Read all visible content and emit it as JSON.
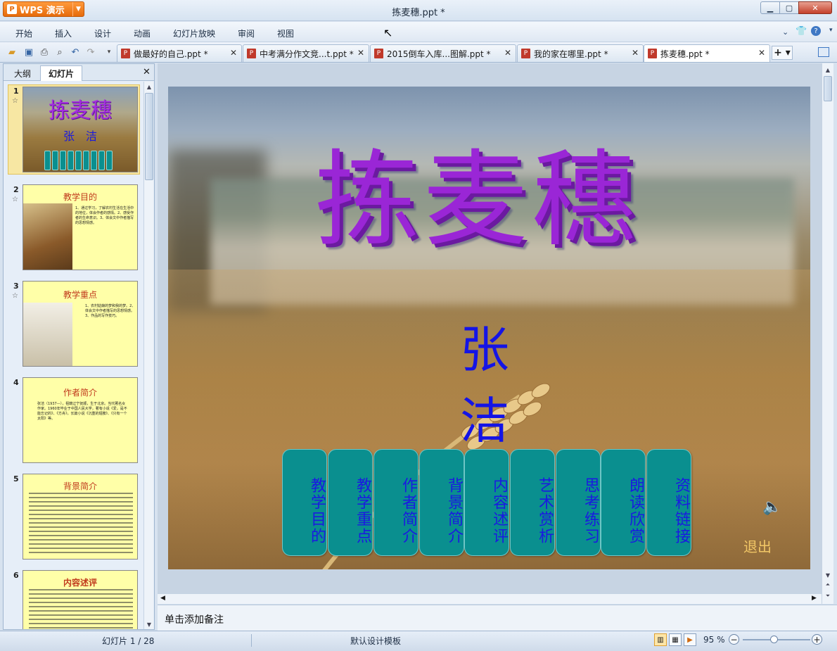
{
  "app": {
    "name": "WPS 演示",
    "window_title": "拣麦穗.ppt *"
  },
  "menu": [
    "开始",
    "插入",
    "设计",
    "动画",
    "幻灯片放映",
    "审阅",
    "视图"
  ],
  "doc_tabs": [
    {
      "label": "做最好的自己.ppt *"
    },
    {
      "label": "中考满分作文竞...t.ppt *"
    },
    {
      "label": "2015倒车入库...图解.ppt *"
    },
    {
      "label": "我的家在哪里.ppt *"
    },
    {
      "label": "拣麦穗.ppt *",
      "active": true
    }
  ],
  "left_panel": {
    "tab_outline": "大纲",
    "tab_slides": "幻灯片",
    "thumbs": [
      {
        "num": "1",
        "title": "拣麦穗",
        "subtitle": "张　洁",
        "selected": true
      },
      {
        "num": "2",
        "title": "教学目的",
        "text": "1、通过学习，了解农村生活在生活中的地位，体会作者的感情。2、感受作者的生命意识。3、体会文中作者描写的思想情感。"
      },
      {
        "num": "3",
        "title": "教学重点",
        "text": "1、农村姑娘的梦和我的梦。2、体会文中作者描写的思想情感。3、作品的写作技巧。"
      },
      {
        "num": "4",
        "title": "作者简介",
        "text": "张洁（1937—），祖籍辽宁抚顺，生于北京。当代著名女作家。1960年毕业于中国人民大学，著有小说《爱，是不能忘记的》、《方舟》，长篇小说《沉重的翅膀》、《只有一个太阳》等。"
      },
      {
        "num": "5",
        "title": "背景简介"
      },
      {
        "num": "6",
        "title": "内容述评"
      }
    ]
  },
  "slide": {
    "title": "拣麦穗",
    "author": "张洁",
    "nav_buttons": [
      "教学目的",
      "教学重点",
      "作者简介",
      "背景简介",
      "内容述评",
      "艺术赏析",
      "思考练习",
      "朗读欣赏",
      "资料链接"
    ],
    "exit_label": "退出"
  },
  "notes_placeholder": "单击添加备注",
  "status": {
    "slide_counter": "幻灯片 1 / 28",
    "template": "默认设计模板",
    "zoom": "95 %"
  }
}
